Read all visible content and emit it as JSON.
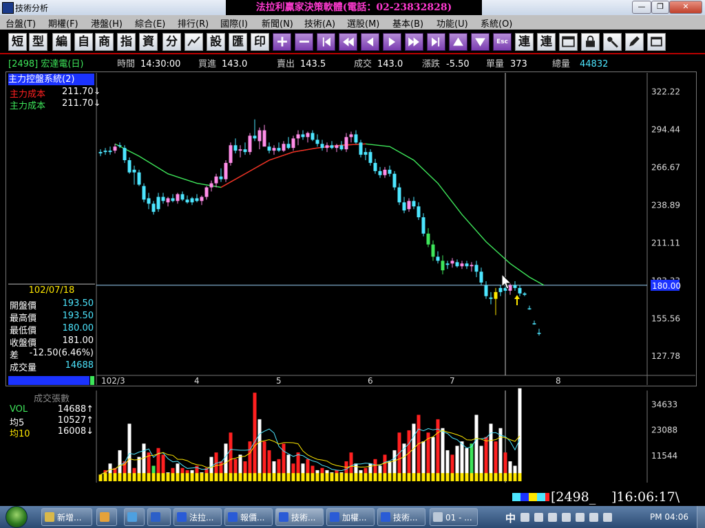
{
  "window": {
    "title": "技術分析",
    "banner": "法拉利贏家決策軟體(電話：02-23832828)",
    "buttons": [
      "—",
      "❐",
      "✕"
    ]
  },
  "menu": [
    "台盤(T)",
    "期權(F)",
    "港盤(H)",
    "綜合(E)",
    "排行(R)",
    "國際(I)",
    "新聞(N)",
    "技術(A)",
    "選股(M)",
    "基本(B)",
    "功能(U)",
    "系統(O)"
  ],
  "toolbar": [
    {
      "label": "短",
      "icon": "text-button"
    },
    {
      "label": "型",
      "icon": "text-button"
    },
    {
      "label": "編",
      "icon": "text-button"
    },
    {
      "label": "自",
      "icon": "text-button"
    },
    {
      "label": "商",
      "icon": "text-button"
    },
    {
      "label": "指",
      "icon": "text-button"
    },
    {
      "label": "資",
      "icon": "text-button"
    },
    {
      "label": "分",
      "icon": "text-button"
    },
    {
      "label": "",
      "icon": "line-chart-icon"
    },
    {
      "label": "設",
      "icon": "text-button"
    },
    {
      "label": "匯",
      "icon": "text-button"
    },
    {
      "label": "印",
      "icon": "text-button"
    },
    {
      "label": "+",
      "icon": "plus-icon"
    },
    {
      "label": "−",
      "icon": "minus-icon"
    },
    {
      "label": "",
      "icon": "step-back-icon"
    },
    {
      "label": "",
      "icon": "fast-back-icon"
    },
    {
      "label": "",
      "icon": "left-icon"
    },
    {
      "label": "",
      "icon": "right-icon"
    },
    {
      "label": "",
      "icon": "fast-forward-icon"
    },
    {
      "label": "",
      "icon": "step-forward-icon"
    },
    {
      "label": "",
      "icon": "up-icon"
    },
    {
      "label": "",
      "icon": "down-icon"
    },
    {
      "label": "Esc",
      "icon": "esc-icon"
    },
    {
      "label": "連",
      "icon": "text-button"
    },
    {
      "label": "連",
      "icon": "text-button"
    },
    {
      "label": "",
      "icon": "window-icon"
    },
    {
      "label": "",
      "icon": "lock-icon"
    },
    {
      "label": "",
      "icon": "tools-icon"
    },
    {
      "label": "",
      "icon": "edit-icon"
    },
    {
      "label": "",
      "icon": "window-restore-icon"
    }
  ],
  "quote": {
    "stock": "[2498] 宏達電(日)",
    "time_label": "時間",
    "time": "14:30:00",
    "bid_label": "買進",
    "bid": "143.0",
    "ask_label": "賣出",
    "ask": "143.5",
    "trade_label": "成交",
    "trade": "143.0",
    "change_label": "漲跌",
    "change": "-5.50",
    "volume_label": "單量",
    "volume": "373",
    "total_label": "總量",
    "total": "44832"
  },
  "indicator": {
    "title": "主力控盤系統(2)",
    "rows": [
      {
        "label": "主力成本",
        "value": "211.70↓",
        "color": "#ff2020"
      },
      {
        "label": "主力成本",
        "value": "211.70↓",
        "color": "#3ee65a"
      }
    ]
  },
  "price_info": {
    "date": "102/07/18",
    "rows": [
      {
        "label": "開盤價",
        "value": "193.50",
        "color": "#4de6ff"
      },
      {
        "label": "最高價",
        "value": "193.50",
        "color": "#4de6ff"
      },
      {
        "label": "最低價",
        "value": "180.00",
        "color": "#4de6ff"
      },
      {
        "label": "收盤價",
        "value": "181.00",
        "color": "#ffffff"
      },
      {
        "label": "差",
        "value": "-12.50(6.46%)",
        "color": "#ffffff"
      },
      {
        "label": "成交量",
        "value": "14688",
        "color": "#4de6ff"
      }
    ]
  },
  "volume_info": {
    "title": "成交張數",
    "rows": [
      {
        "label": "VOL",
        "value": "14688↑",
        "color": "#3ee65a"
      },
      {
        "label": "均5",
        "value": "10527↑",
        "color": "#ffffff"
      },
      {
        "label": "均10",
        "value": "16008↓",
        "color": "#ffe800"
      }
    ]
  },
  "chart_data": {
    "type": "candlestick",
    "ylim": [
      113.72,
      336.22
    ],
    "y_ticks": [
      "322.22",
      "294.44",
      "266.67",
      "238.89",
      "211.11",
      "183.33",
      "155.56",
      "127.78"
    ],
    "current_label": "180.00",
    "current_value": 180.0,
    "x_ticks": [
      {
        "label": "102/3",
        "index": 0
      },
      {
        "label": "4",
        "index": 20
      },
      {
        "label": "5",
        "index": 37
      },
      {
        "label": "6",
        "index": 56
      },
      {
        "label": "7",
        "index": 73
      },
      {
        "label": "8",
        "index": 95
      }
    ],
    "crosshair_index": 84,
    "candles": [
      [
        277,
        280,
        275,
        278,
        "c"
      ],
      [
        278,
        281,
        276,
        279,
        "c"
      ],
      [
        279,
        282,
        276,
        278,
        "c"
      ],
      [
        279,
        284,
        277,
        282,
        "m"
      ],
      [
        283,
        285,
        281,
        283,
        "c"
      ],
      [
        281,
        283,
        270,
        272,
        "c"
      ],
      [
        272,
        274,
        262,
        263,
        "c"
      ],
      [
        263,
        268,
        254,
        265,
        "c"
      ],
      [
        263,
        265,
        253,
        254,
        "c"
      ],
      [
        253,
        255,
        241,
        243,
        "c"
      ],
      [
        244,
        248,
        236,
        240,
        "c"
      ],
      [
        240,
        242,
        232,
        234,
        "c"
      ],
      [
        236,
        248,
        234,
        245,
        "c"
      ],
      [
        245,
        248,
        240,
        242,
        "c"
      ],
      [
        241,
        245,
        238,
        244,
        "m"
      ],
      [
        244,
        247,
        241,
        242,
        "c"
      ],
      [
        242,
        248,
        240,
        247,
        "m"
      ],
      [
        247,
        249,
        242,
        243,
        "c"
      ],
      [
        243,
        246,
        240,
        241,
        "c"
      ],
      [
        241,
        245,
        239,
        244,
        "c"
      ],
      [
        244,
        247,
        241,
        242,
        "c"
      ],
      [
        242,
        246,
        239,
        245,
        "m"
      ],
      [
        245,
        253,
        243,
        252,
        "m"
      ],
      [
        252,
        257,
        249,
        255,
        "m"
      ],
      [
        255,
        262,
        252,
        260,
        "m"
      ],
      [
        260,
        266,
        256,
        258,
        "c"
      ],
      [
        258,
        272,
        256,
        270,
        "m"
      ],
      [
        270,
        285,
        268,
        283,
        "m"
      ],
      [
        283,
        288,
        277,
        279,
        "c"
      ],
      [
        279,
        283,
        274,
        280,
        "m"
      ],
      [
        280,
        285,
        276,
        278,
        "c"
      ],
      [
        278,
        292,
        276,
        290,
        "m"
      ],
      [
        290,
        302,
        286,
        288,
        "c"
      ],
      [
        286,
        296,
        280,
        294,
        "m"
      ],
      [
        294,
        298,
        286,
        282,
        "m"
      ],
      [
        282,
        285,
        277,
        279,
        "c"
      ],
      [
        279,
        283,
        276,
        281,
        "m"
      ],
      [
        281,
        285,
        278,
        279,
        "c"
      ],
      [
        279,
        286,
        278,
        284,
        "m"
      ],
      [
        284,
        289,
        280,
        281,
        "c"
      ],
      [
        281,
        290,
        279,
        288,
        "m"
      ],
      [
        288,
        294,
        283,
        291,
        "m"
      ],
      [
        291,
        294,
        287,
        289,
        "c"
      ],
      [
        289,
        293,
        285,
        292,
        "m"
      ],
      [
        292,
        294,
        286,
        287,
        "c"
      ],
      [
        287,
        291,
        282,
        284,
        "c"
      ],
      [
        284,
        287,
        279,
        281,
        "c"
      ],
      [
        281,
        285,
        278,
        283,
        "m"
      ],
      [
        283,
        286,
        280,
        281,
        "c"
      ],
      [
        281,
        284,
        278,
        283,
        "m"
      ],
      [
        283,
        286,
        279,
        280,
        "c"
      ],
      [
        280,
        292,
        278,
        289,
        "m"
      ],
      [
        289,
        293,
        285,
        291,
        "m"
      ],
      [
        291,
        294,
        284,
        285,
        "c"
      ],
      [
        285,
        287,
        274,
        276,
        "c"
      ],
      [
        276,
        281,
        272,
        278,
        "c"
      ],
      [
        278,
        280,
        268,
        270,
        "c"
      ],
      [
        270,
        273,
        262,
        264,
        "c"
      ],
      [
        264,
        267,
        259,
        261,
        "c"
      ],
      [
        261,
        267,
        259,
        265,
        "m"
      ],
      [
        265,
        268,
        260,
        262,
        "c"
      ],
      [
        262,
        264,
        250,
        252,
        "c"
      ],
      [
        252,
        255,
        239,
        241,
        "c"
      ],
      [
        241,
        245,
        233,
        235,
        "c"
      ],
      [
        236,
        244,
        234,
        242,
        "m"
      ],
      [
        242,
        245,
        236,
        238,
        "c"
      ],
      [
        238,
        241,
        228,
        230,
        "c"
      ],
      [
        230,
        233,
        216,
        218,
        "c"
      ],
      [
        218,
        222,
        208,
        210,
        "g"
      ],
      [
        210,
        213,
        198,
        201,
        "g"
      ],
      [
        201,
        205,
        196,
        198,
        "c"
      ],
      [
        198,
        202,
        188,
        191,
        "g"
      ],
      [
        195,
        198,
        192,
        196,
        "c"
      ],
      [
        196,
        200,
        193,
        198,
        "m"
      ],
      [
        197,
        199,
        193,
        194,
        "c"
      ],
      [
        194,
        198,
        192,
        196,
        "m"
      ],
      [
        196,
        198,
        192,
        194,
        "c"
      ],
      [
        194,
        197,
        190,
        195,
        "m"
      ],
      [
        195,
        198,
        186,
        190,
        "c"
      ],
      [
        190,
        193,
        180,
        182,
        "c"
      ],
      [
        180,
        183,
        170,
        172,
        "c"
      ],
      [
        171,
        175,
        166,
        170,
        "c"
      ],
      [
        170,
        178,
        158,
        175,
        "y"
      ],
      [
        175,
        180,
        172,
        178,
        "c"
      ],
      [
        178,
        182,
        174,
        176,
        "c"
      ],
      [
        176,
        182,
        173,
        180,
        "m"
      ],
      [
        180,
        183,
        176,
        178,
        "c"
      ],
      [
        178,
        180,
        172,
        174,
        "c"
      ],
      [
        173,
        175,
        172,
        174,
        "c"
      ],
      [
        163,
        165,
        162,
        163,
        "c"
      ],
      [
        152,
        154,
        151,
        152,
        "c"
      ],
      [
        145,
        148,
        143,
        145,
        "c"
      ]
    ],
    "ma": [
      [
        3,
        284
      ],
      [
        8,
        275
      ],
      [
        14,
        262
      ],
      [
        20,
        255
      ],
      [
        25,
        252
      ],
      [
        30,
        262
      ],
      [
        35,
        272
      ],
      [
        40,
        278
      ],
      [
        45,
        281
      ],
      [
        50,
        283
      ],
      [
        55,
        284
      ],
      [
        60,
        282
      ],
      [
        65,
        272
      ],
      [
        70,
        255
      ],
      [
        75,
        232
      ],
      [
        80,
        212
      ],
      [
        85,
        196
      ],
      [
        89,
        186
      ],
      [
        92,
        180
      ]
    ],
    "volume_ticks": [
      "34633",
      "23088",
      "11544"
    ],
    "volume_ylim": [
      0,
      41000
    ],
    "volume": [
      [
        3000,
        "r"
      ],
      [
        5000,
        "r"
      ],
      [
        8000,
        "w"
      ],
      [
        6000,
        "r"
      ],
      [
        14000,
        "w"
      ],
      [
        9000,
        "r"
      ],
      [
        26000,
        "w"
      ],
      [
        6000,
        "r"
      ],
      [
        11000,
        "w"
      ],
      [
        17000,
        "w"
      ],
      [
        13000,
        "r"
      ],
      [
        7000,
        "g"
      ],
      [
        15000,
        "r"
      ],
      [
        12000,
        "r"
      ],
      [
        4000,
        "w"
      ],
      [
        6000,
        "r"
      ],
      [
        8000,
        "w"
      ],
      [
        6000,
        "r"
      ],
      [
        5000,
        "r"
      ],
      [
        5000,
        "w"
      ],
      [
        7000,
        "r"
      ],
      [
        4000,
        "w"
      ],
      [
        6000,
        "r"
      ],
      [
        11000,
        "w"
      ],
      [
        13000,
        "r"
      ],
      [
        9000,
        "r"
      ],
      [
        17000,
        "w"
      ],
      [
        22000,
        "r"
      ],
      [
        10000,
        "r"
      ],
      [
        12000,
        "w"
      ],
      [
        9000,
        "r"
      ],
      [
        18000,
        "r"
      ],
      [
        40000,
        "r"
      ],
      [
        28000,
        "w"
      ],
      [
        18000,
        "r"
      ],
      [
        14000,
        "r"
      ],
      [
        9000,
        "w"
      ],
      [
        10000,
        "r"
      ],
      [
        17000,
        "r"
      ],
      [
        12000,
        "w"
      ],
      [
        8000,
        "r"
      ],
      [
        13000,
        "r"
      ],
      [
        8000,
        "w"
      ],
      [
        10000,
        "r"
      ],
      [
        7000,
        "r"
      ],
      [
        5000,
        "w"
      ],
      [
        6000,
        "r"
      ],
      [
        5000,
        "w"
      ],
      [
        4000,
        "w"
      ],
      [
        5000,
        "r"
      ],
      [
        4000,
        "w"
      ],
      [
        9000,
        "r"
      ],
      [
        13000,
        "r"
      ],
      [
        8000,
        "w"
      ],
      [
        5000,
        "w"
      ],
      [
        6000,
        "r"
      ],
      [
        8000,
        "w"
      ],
      [
        10000,
        "r"
      ],
      [
        7000,
        "w"
      ],
      [
        12000,
        "r"
      ],
      [
        9000,
        "w"
      ],
      [
        14000,
        "w"
      ],
      [
        22000,
        "r"
      ],
      [
        17000,
        "w"
      ],
      [
        23000,
        "r"
      ],
      [
        26000,
        "w"
      ],
      [
        30000,
        "r"
      ],
      [
        18000,
        "w"
      ],
      [
        22000,
        "r"
      ],
      [
        20000,
        "w"
      ],
      [
        28000,
        "r"
      ],
      [
        24000,
        "w"
      ],
      [
        14000,
        "w"
      ],
      [
        12000,
        "r"
      ],
      [
        16000,
        "w"
      ],
      [
        18000,
        "w"
      ],
      [
        15000,
        "w"
      ],
      [
        17000,
        "g"
      ],
      [
        30000,
        "w"
      ],
      [
        16000,
        "w"
      ],
      [
        20000,
        "r"
      ],
      [
        26000,
        "w"
      ],
      [
        18000,
        "r"
      ],
      [
        24000,
        "w"
      ],
      [
        13000,
        "r"
      ],
      [
        9000,
        "w"
      ],
      [
        7000,
        "w"
      ],
      [
        42000,
        "w"
      ]
    ]
  },
  "status": {
    "code": "[2498_",
    "clock": "]16:06:17\\"
  },
  "taskbar": {
    "tasks": [
      "新增...",
      "",
      "",
      "",
      "法拉...",
      "報價...",
      "技術...",
      "加權...",
      "技術...",
      "01 - ..."
    ],
    "ime": "中",
    "time": "PM 04:06"
  }
}
